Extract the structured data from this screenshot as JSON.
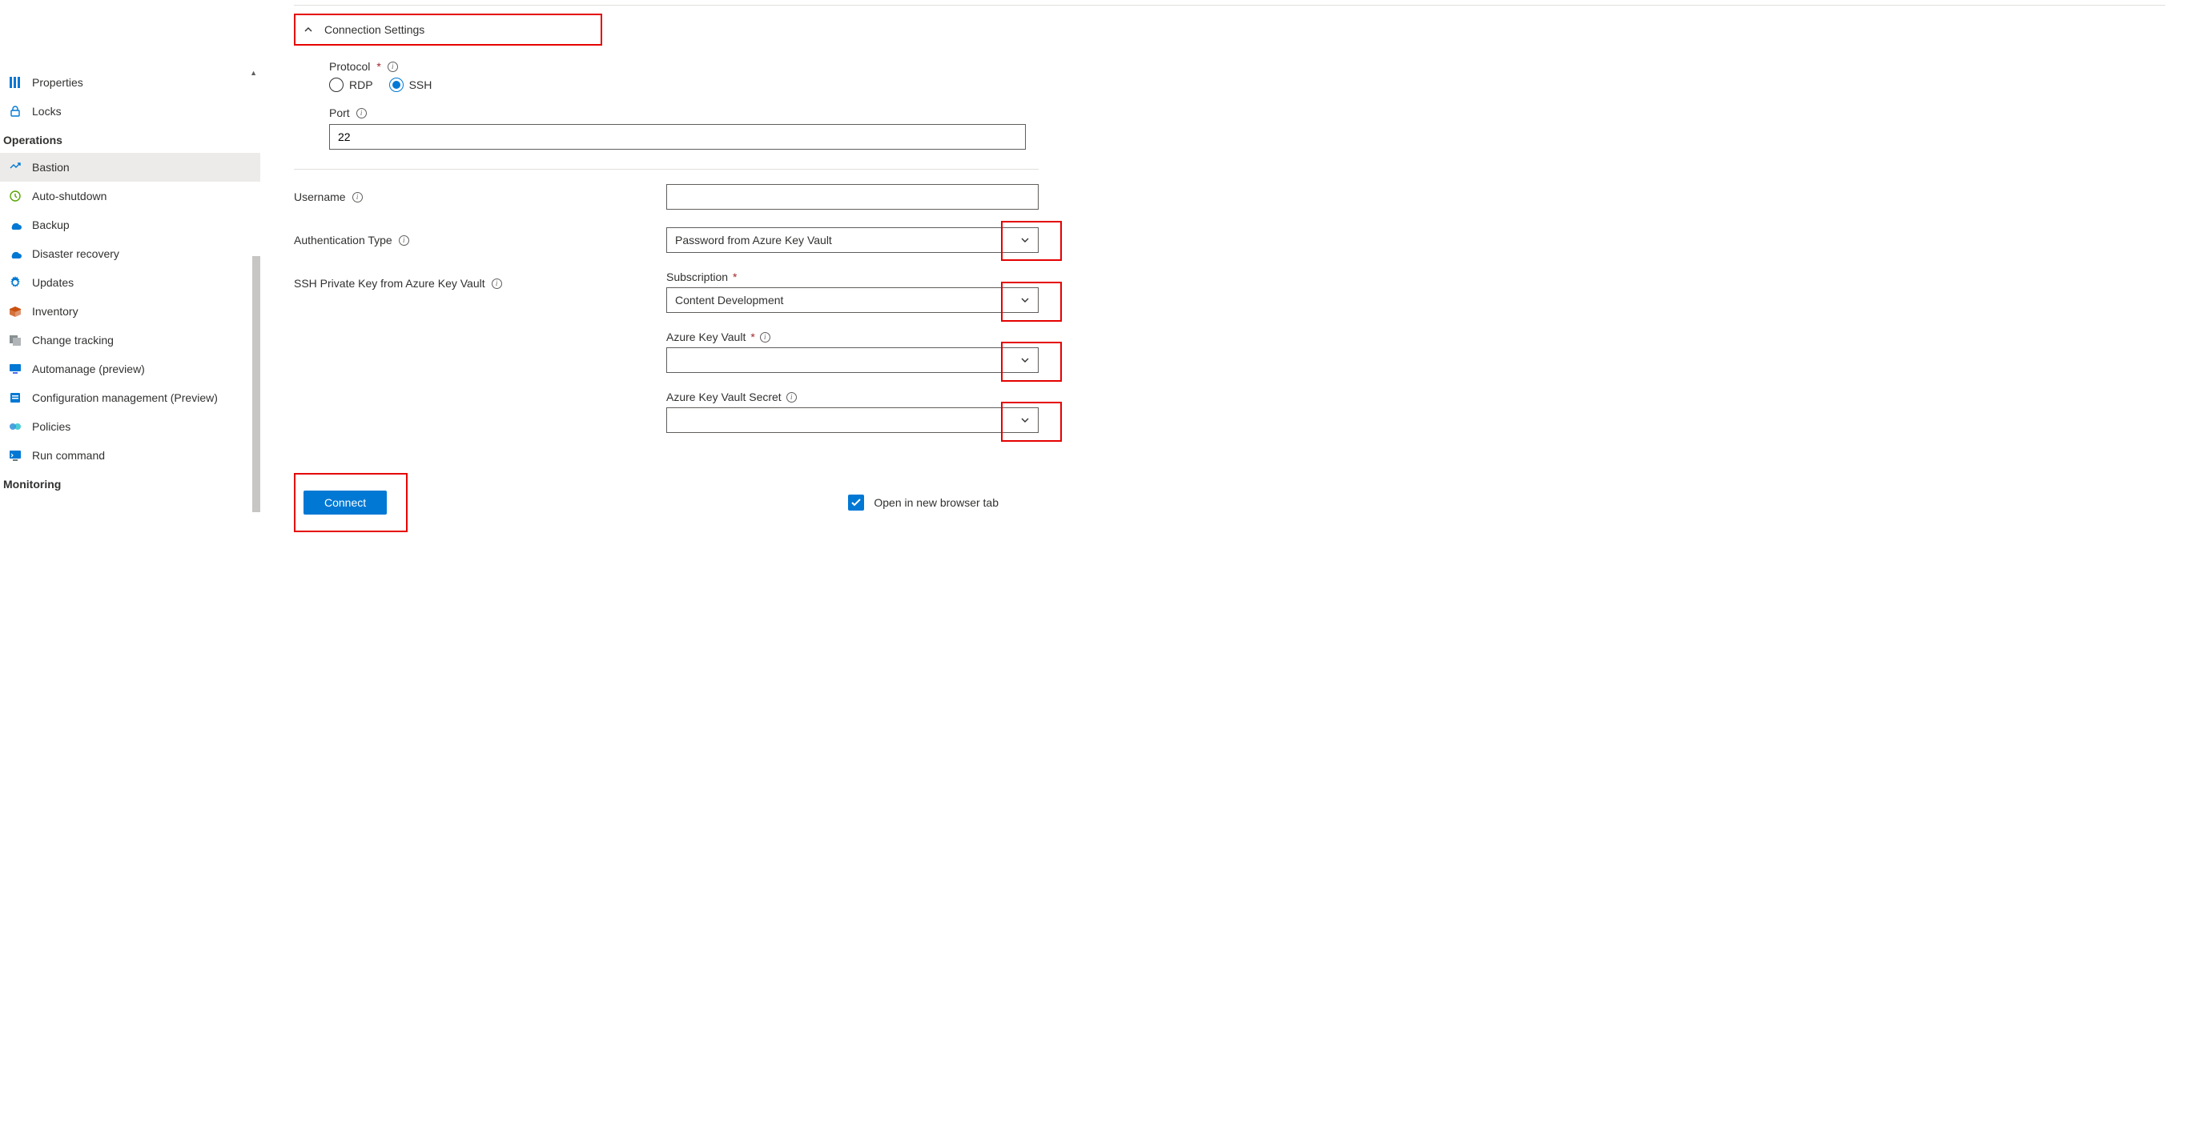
{
  "sidebar": {
    "items_top": [
      {
        "label": "Properties",
        "icon": "properties"
      },
      {
        "label": "Locks",
        "icon": "lock"
      }
    ],
    "section1": "Operations",
    "items_ops": [
      {
        "label": "Bastion",
        "icon": "bastion",
        "selected": true
      },
      {
        "label": "Auto-shutdown",
        "icon": "clock"
      },
      {
        "label": "Backup",
        "icon": "backup"
      },
      {
        "label": "Disaster recovery",
        "icon": "recovery"
      },
      {
        "label": "Updates",
        "icon": "gear"
      },
      {
        "label": "Inventory",
        "icon": "box"
      },
      {
        "label": "Change tracking",
        "icon": "tracking"
      },
      {
        "label": "Automanage (preview)",
        "icon": "monitor"
      },
      {
        "label": "Configuration management (Preview)",
        "icon": "config"
      },
      {
        "label": "Policies",
        "icon": "policy"
      },
      {
        "label": "Run command",
        "icon": "runcmd"
      }
    ],
    "section2": "Monitoring"
  },
  "main": {
    "connection_settings": "Connection Settings",
    "protocol_label": "Protocol",
    "protocol_options": {
      "rdp": "RDP",
      "ssh": "SSH"
    },
    "protocol_selected": "ssh",
    "port_label": "Port",
    "port_value": "22",
    "username_label": "Username",
    "username_value": "",
    "auth_type_label": "Authentication Type",
    "auth_type_value": "Password from Azure Key Vault",
    "ssh_key_label": "SSH Private Key from Azure Key Vault",
    "subscription_label": "Subscription",
    "subscription_value": "Content Development",
    "keyvault_label": "Azure Key Vault",
    "keyvault_value": "",
    "secret_label": "Azure Key Vault Secret",
    "secret_value": "",
    "connect_button": "Connect",
    "open_new_tab_label": "Open in new browser tab",
    "open_new_tab_checked": true
  }
}
